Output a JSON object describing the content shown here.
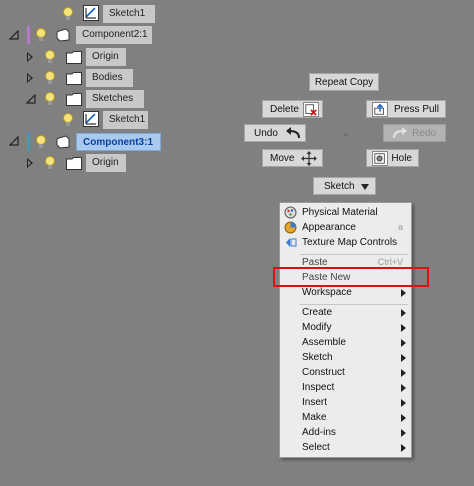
{
  "browser": {
    "nodes": [
      {
        "label": "Sketch1"
      },
      {
        "label": "Component2:1"
      },
      {
        "label": "Origin"
      },
      {
        "label": "Bodies"
      },
      {
        "label": "Sketches"
      },
      {
        "label": "Sketch1"
      },
      {
        "label": "Component3:1"
      },
      {
        "label": "Origin"
      }
    ]
  },
  "marking_menu": {
    "repeat": "Repeat Copy",
    "delete": "Delete",
    "press_pull": "Press Pull",
    "undo": "Undo",
    "redo": "Redo",
    "move": "Move",
    "hole": "Hole",
    "sketch": "Sketch"
  },
  "context_menu": {
    "physical_material": "Physical Material",
    "appearance": "Appearance",
    "appearance_shortcut": "a",
    "texture_map": "Texture Map Controls",
    "paste": "Paste",
    "paste_shortcut": "Ctrl+V",
    "paste_new": "Paste New",
    "workspace": "Workspace",
    "create": "Create",
    "modify": "Modify",
    "assemble": "Assemble",
    "sketch": "Sketch",
    "construct": "Construct",
    "inspect": "Inspect",
    "insert": "Insert",
    "make": "Make",
    "addins": "Add-ins",
    "select": "Select"
  },
  "colors": {
    "background": "#808080",
    "selected_node": "#a9c9ee",
    "highlight_box": "#e01010"
  }
}
